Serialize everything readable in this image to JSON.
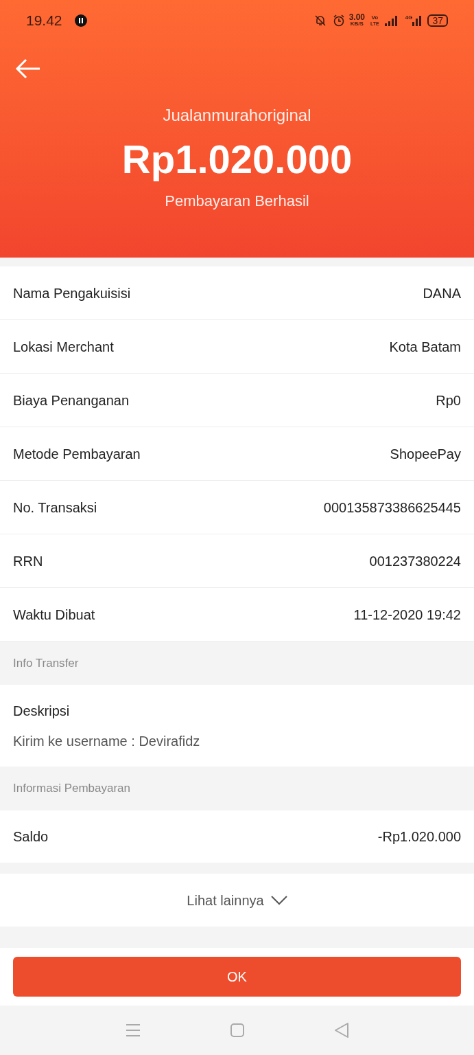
{
  "status_bar": {
    "time": "19.42",
    "speed": "3.00",
    "speed_unit": "KB/S",
    "volte_top": "Vo",
    "volte_bottom": "LTE",
    "network": "4G",
    "battery": "37"
  },
  "header": {
    "merchant": "Jualanmurahoriginal",
    "amount": "Rp1.020.000",
    "status": "Pembayaran Berhasil"
  },
  "details": [
    {
      "label": "Nama Pengakuisisi",
      "value": "DANA"
    },
    {
      "label": "Lokasi Merchant",
      "value": "Kota Batam"
    },
    {
      "label": "Biaya Penanganan",
      "value": "Rp0"
    },
    {
      "label": "Metode Pembayaran",
      "value": "ShopeePay"
    },
    {
      "label": "No. Transaksi",
      "value": "000135873386625445"
    },
    {
      "label": "RRN",
      "value": "001237380224"
    },
    {
      "label": "Waktu Dibuat",
      "value": "11-12-2020 19:42"
    }
  ],
  "transfer_info": {
    "heading": "Info Transfer",
    "label": "Deskripsi",
    "text": "Kirim ke username : Devirafidz"
  },
  "payment_info": {
    "heading": "Informasi Pembayaran",
    "label": "Saldo",
    "value": "-Rp1.020.000"
  },
  "more_link": "Lihat lainnya",
  "ok_button": "OK"
}
